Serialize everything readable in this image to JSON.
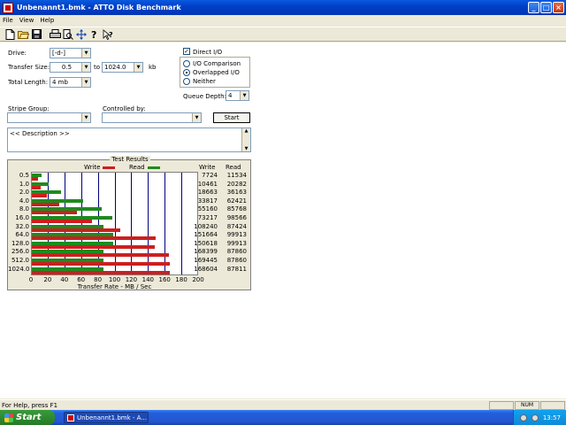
{
  "window": {
    "title": "Unbenannt1.bmk - ATTO Disk Benchmark",
    "minimize": "_",
    "maximize": "□",
    "close": "×"
  },
  "menu": [
    "File",
    "View",
    "Help"
  ],
  "toolbar_icons": [
    "new-file-icon",
    "open-folder-icon",
    "save-icon",
    "print-icon",
    "print-preview-icon",
    "move-icon",
    "help-icon",
    "context-help-icon"
  ],
  "form": {
    "drive_label": "Drive:",
    "drive_value": "[-d-]",
    "transfer_size_label": "Transfer Size:",
    "transfer_from": "0.5",
    "to_label": "to",
    "transfer_to": "1024.0",
    "kb_label": "kb",
    "total_length_label": "Total Length:",
    "total_length_value": "4 mb",
    "direct_io_label": "Direct I/O",
    "direct_io_checked": true,
    "io_options": [
      {
        "label": "I/O Comparison",
        "selected": false
      },
      {
        "label": "Overlapped I/O",
        "selected": true
      },
      {
        "label": "Neither",
        "selected": false
      }
    ],
    "queue_depth_label": "Queue Depth:",
    "queue_depth_value": "4",
    "stripe_group_label": "Stripe Group:",
    "stripe_group_value": "",
    "controlled_by_label": "Controlled by:",
    "controlled_by_value": "",
    "start_label": "Start",
    "description": "<< Description >>"
  },
  "results": {
    "title": "Test Results",
    "write_legend": "Write",
    "read_legend": "Read",
    "write_col": "Write",
    "read_col": "Read",
    "xlabel": "Transfer Rate - MB / Sec",
    "write_color": "#cc1f1f",
    "read_color": "#1f8a1f"
  },
  "chart_data": {
    "type": "bar",
    "orientation": "horizontal",
    "title": "Test Results",
    "xlabel": "Transfer Rate - MB / Sec",
    "xlim": [
      0,
      200
    ],
    "xticks": [
      "0",
      "20",
      "40",
      "60",
      "80",
      "100",
      "120",
      "140",
      "160",
      "180",
      "200"
    ],
    "categories": [
      "0.5",
      "1.0",
      "2.0",
      "4.0",
      "8.0",
      "16.0",
      "32.0",
      "64.0",
      "128.0",
      "256.0",
      "512.0",
      "1024.0"
    ],
    "series": [
      {
        "name": "Write",
        "values": [
          7.5,
          10.2,
          18.2,
          33.0,
          53.9,
          71.5,
          105.7,
          148.1,
          147.1,
          164.5,
          165.5,
          164.7
        ],
        "table": [
          "7724",
          "10461",
          "18663",
          "33817",
          "55160",
          "73217",
          "108240",
          "151664",
          "150618",
          "168399",
          "169445",
          "168604"
        ]
      },
      {
        "name": "Read",
        "values": [
          11.3,
          19.8,
          35.3,
          61.0,
          83.8,
          96.3,
          85.4,
          97.6,
          97.6,
          85.8,
          85.8,
          85.8
        ],
        "table": [
          "11534",
          "20282",
          "36163",
          "62421",
          "85768",
          "98566",
          "87424",
          "99913",
          "99913",
          "87860",
          "87860",
          "87811"
        ]
      }
    ],
    "grid": true,
    "legend": "top"
  },
  "statusbar": {
    "text": "For Help, press F1",
    "num": "NUM"
  },
  "taskbar": {
    "start": "Start",
    "task_label": "Unbenannt1.bmk - A...",
    "clock": "13:57"
  }
}
